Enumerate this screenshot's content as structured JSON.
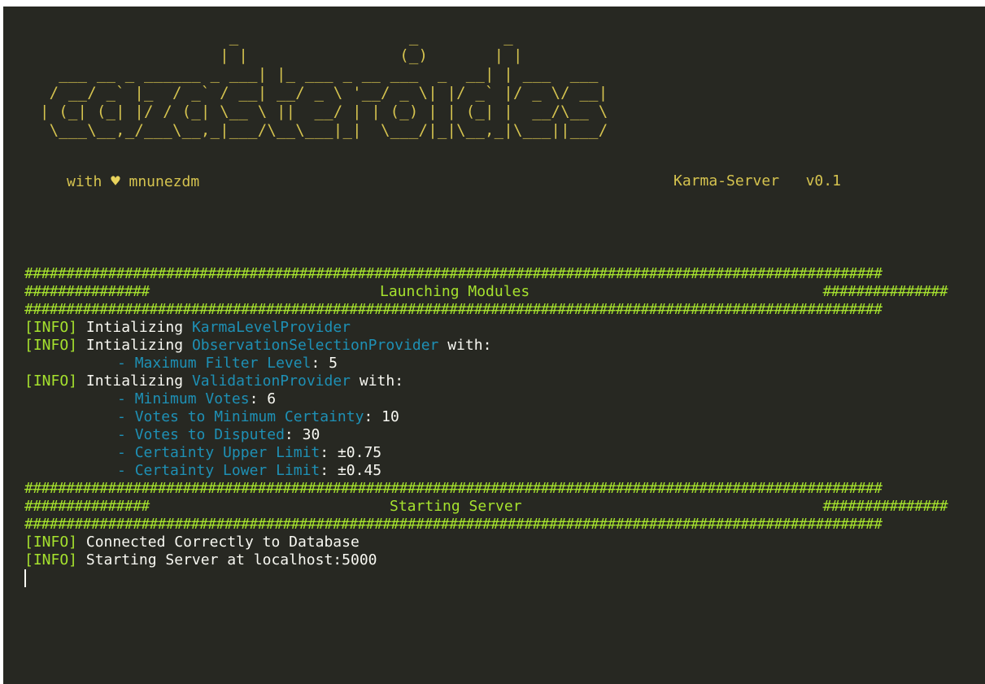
{
  "banner": {
    "ascii_art": "                    _                  _         _\n                   | |                (_)       | |\n  ___ __ _ ______ _ ___| |_ ___ _ __ ___  _  __| | ___  ___\n / __/ _` |_  / _` / __| __/ _ \\ '__/ _ \\| |/ _` |/ _ \\/ __|\n| (_| (_| |/ / (_| \\__ \\ ||  __/ | | (_) | | (_| |  __/\\__ \\\n \\___\\__,_/___\\__,_|___/\\__\\___|_|  \\___/|_|\\__,_|\\___||___/",
    "tagline_prefix": "with",
    "heart": "♥",
    "author": "mnunezdm",
    "server_name": "Karma-Server",
    "version": "v0.1"
  },
  "hash_border": "#######################################################################################################",
  "section_hash_block": "###############",
  "sections": {
    "launching": {
      "title": "Launching Modules"
    },
    "starting": {
      "title": "Starting Server"
    }
  },
  "log": {
    "info_tag": "[INFO]",
    "init_word": "Intializing",
    "with_word": "with:",
    "dash": "- ",
    "colon": ": ",
    "karma_module": "KarmaLevelProvider",
    "obs_module": "ObservationSelectionProvider",
    "obs_params": [
      {
        "name": "Maximum Filter Level",
        "value": "5"
      }
    ],
    "val_module": "ValidationProvider",
    "val_params": [
      {
        "name": "Minimum Votes",
        "value": "6"
      },
      {
        "name": "Votes to Minimum Certainty",
        "value": "10"
      },
      {
        "name": "Votes to Disputed",
        "value": "30"
      },
      {
        "name": "Certainty Upper Limit",
        "value": "±0.75"
      },
      {
        "name": "Certainty Lower Limit",
        "value": "±0.45"
      }
    ],
    "db_message": "Connected Correctly to Database",
    "server_message": "Starting Server at localhost:5000"
  },
  "colors": {
    "background": "#272822",
    "banner": "#d5c34f",
    "info_green": "#a6e22e",
    "module_blue": "#1e90b5",
    "text": "#f8f8f2"
  }
}
